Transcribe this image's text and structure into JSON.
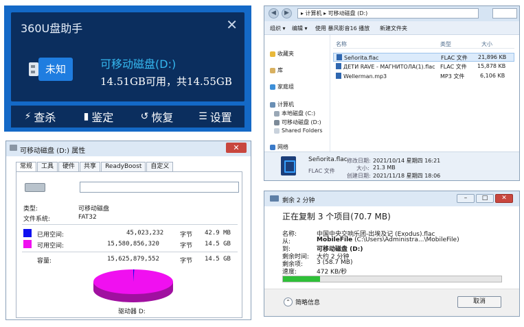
{
  "app360": {
    "title": "360U盘助手",
    "close": "✕",
    "badge": "未知",
    "drive_name": "可移动磁盘(D:)",
    "capacity": "14.51GB可用，共14.55GB",
    "tools": [
      {
        "label": "查杀",
        "icon": "⚡"
      },
      {
        "label": "鉴定",
        "icon": "▮"
      },
      {
        "label": "恢复",
        "icon": "↺"
      },
      {
        "label": "设置",
        "icon": "☰"
      }
    ]
  },
  "explorer": {
    "path": "▸ 计算机 ▸ 可移动磁盘 (D:)",
    "back": "◀",
    "forward": "▶",
    "cmd": {
      "organize": "组织 ▾",
      "open": "编辑 ▾",
      "play": "使用 暴风影音16 播放",
      "new_folder": "新建文件夹"
    },
    "nav": {
      "favorites": "收藏夹",
      "libraries": "库",
      "homegroup": "家庭组",
      "computer": "计算机",
      "local_c": "本地磁盘 (C:)",
      "removable_d": "可移动磁盘 (D:)",
      "shared": "Shared Folders",
      "network": "网络"
    },
    "columns": {
      "name": "名称",
      "type": "类型",
      "size": "大小"
    },
    "files": [
      {
        "name": "Señorita.flac",
        "type": "FLAC 文件",
        "size": "21,896 KB"
      },
      {
        "name": "ДЕТИ RAVE - МАГНИТОЛА(1).flac",
        "type": "FLAC 文件",
        "size": "15,878 KB"
      },
      {
        "name": "Wellerman.mp3",
        "type": "MP3 文件",
        "size": "6,106 KB"
      }
    ],
    "details": {
      "name": "Señorita.flac",
      "type": "FLAC 文件",
      "modified_label": "修改日期:",
      "modified": "2021/10/14 星期四 16:21",
      "size_label": "大小:",
      "size": "21.3 MB",
      "created_label": "创建日期:",
      "created": "2021/11/18 星期四 18:06"
    }
  },
  "props": {
    "title": "可移动磁盘 (D:) 属性",
    "close": "✕",
    "tabs": [
      "常规",
      "工具",
      "硬件",
      "共享",
      "ReadyBoost",
      "自定义"
    ],
    "type_label": "类型:",
    "type_value": "可移动磁盘",
    "fs_label": "文件系统:",
    "fs_value": "FAT32",
    "used_label": "已用空间:",
    "used_bytes": "45,023,232",
    "used_unit": "字节",
    "used_h": "42.9 MB",
    "free_label": "可用空间:",
    "free_bytes": "15,580,856,320",
    "free_unit": "字节",
    "free_h": "14.5 GB",
    "cap_label": "容量:",
    "cap_bytes": "15,625,879,552",
    "cap_unit": "字节",
    "cap_h": "14.5 GB",
    "drive_label": "驱动器 D:",
    "colors": {
      "used": "#1010f0",
      "free": "#f010f0"
    }
  },
  "copy": {
    "title": "剩余 2 分钟",
    "heading": "正在复制 3 个项目(70.7 MB)",
    "name_label": "名称:",
    "name_value": "中国中央交响乐团-出埃及记 (Exodus).flac",
    "from_label": "从:",
    "from_bold": "MobileFile",
    "from_rest": "(C:\\Users\\Administra...\\MobileFile)",
    "to_label": "到:",
    "to_value": "可移动磁盘 (D:)",
    "time_label": "剩余时间:",
    "time_value": "大约 2 分钟",
    "items_label": "剩余项:",
    "items_value": "3 (58.7 MB)",
    "speed_label": "速度:",
    "speed_value": "472 KB/秒",
    "progress": 0.17,
    "less_info": "简略信息",
    "cancel": "取消"
  }
}
